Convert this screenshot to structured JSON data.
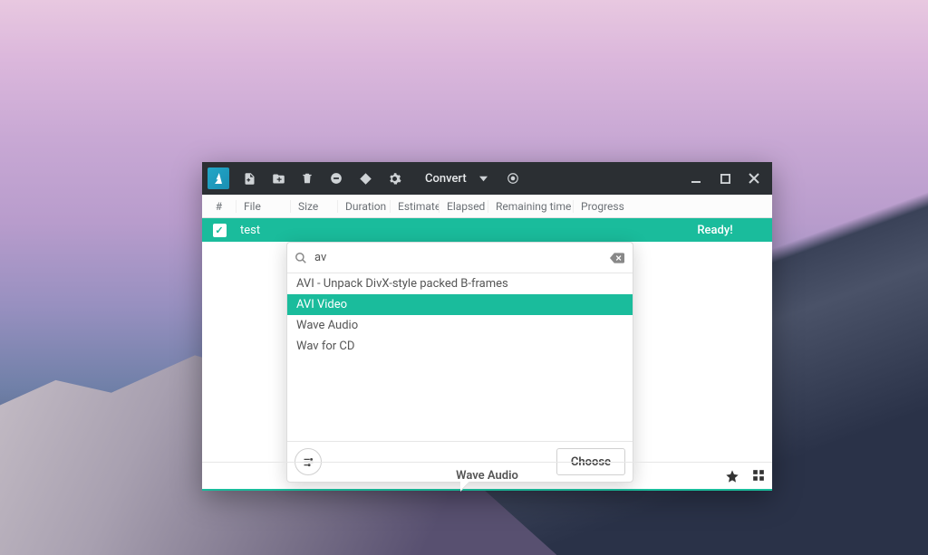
{
  "colors": {
    "accent": "#1abc9c",
    "titlebar_bg": "#2b2f33"
  },
  "toolbar": {
    "convert_label": "Convert"
  },
  "columns": {
    "num": "#",
    "file": "File",
    "size": "Size",
    "duration": "Duration",
    "estimate": "Estimate",
    "elapsed": "Elapsed t",
    "remaining": "Remaining time",
    "progress": "Progress"
  },
  "row": {
    "checked": true,
    "file": "test",
    "status": "Ready!"
  },
  "popover": {
    "search_value": "av",
    "items": [
      {
        "label": "AVI - Unpack DivX-style packed B-frames",
        "selected": false
      },
      {
        "label": "AVI Video",
        "selected": true
      },
      {
        "label": "Wave Audio",
        "selected": false
      },
      {
        "label": "Wav for CD",
        "selected": false
      }
    ],
    "choose_label": "Choose"
  },
  "bottom": {
    "current_format": "Wave Audio"
  }
}
